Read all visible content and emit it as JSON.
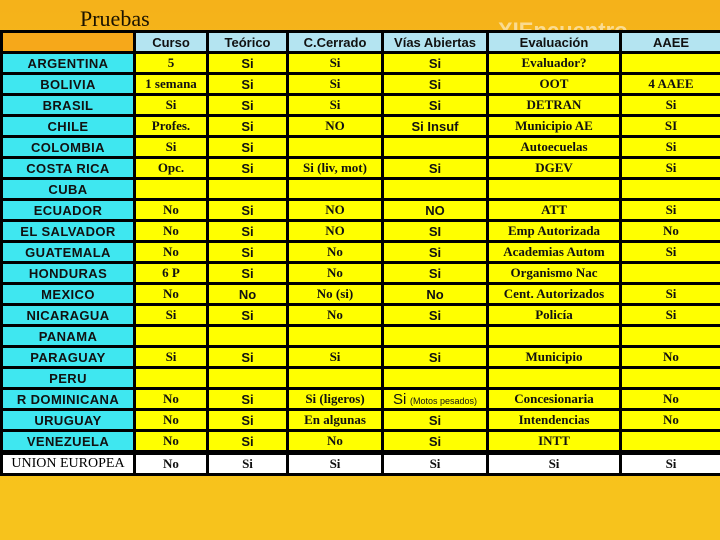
{
  "header": {
    "title": "Pruebas",
    "brand": "XIEncuentro"
  },
  "table": {
    "columns": [
      "Curso",
      "Teórico",
      "C.Cerrado",
      "Vías Abiertas",
      "Evaluación",
      "AAEE"
    ],
    "rows": [
      {
        "country": "ARGENTINA",
        "curso": "5",
        "teorico": "Si",
        "cerrado": "Si",
        "vias": "Si",
        "evaluacion": "Evaluador?",
        "aaee": ""
      },
      {
        "country": "BOLIVIA",
        "curso": "1 semana",
        "teorico": "Si",
        "cerrado": "Si",
        "vias": "Si",
        "evaluacion": "OOT",
        "aaee": "4 AAEE"
      },
      {
        "country": "BRASIL",
        "curso": "Si",
        "teorico": "Si",
        "cerrado": "Si",
        "vias": "Si",
        "evaluacion": "DETRAN",
        "aaee": "Si"
      },
      {
        "country": "CHILE",
        "curso": "Profes.",
        "teorico": "Si",
        "cerrado": "NO",
        "vias": "Si Insuf",
        "evaluacion": "Municipio AE",
        "aaee": "SI"
      },
      {
        "country": "COLOMBIA",
        "curso": "Si",
        "teorico": "Si",
        "cerrado": "",
        "vias": "",
        "evaluacion": "Autoecuelas",
        "aaee": "Si"
      },
      {
        "country": "COSTA RICA",
        "curso": "Opc.",
        "teorico": "Si",
        "cerrado": "Si (liv, mot)",
        "vias": "Si",
        "evaluacion": "DGEV",
        "aaee": "Si"
      },
      {
        "country": "CUBA",
        "curso": "",
        "teorico": "",
        "cerrado": "",
        "vias": "",
        "evaluacion": "",
        "aaee": ""
      },
      {
        "country": "ECUADOR",
        "curso": "No",
        "teorico": "Si",
        "cerrado": "NO",
        "vias": "NO",
        "evaluacion": "ATT",
        "aaee": "Si"
      },
      {
        "country": "EL SALVADOR",
        "curso": "No",
        "teorico": "Si",
        "cerrado": "NO",
        "vias": "SI",
        "evaluacion": "Emp Autorizada",
        "aaee": "No"
      },
      {
        "country": "GUATEMALA",
        "curso": "No",
        "teorico": "Si",
        "cerrado": "No",
        "vias": "Si",
        "evaluacion": "Academias Autom",
        "aaee": "Si"
      },
      {
        "country": "HONDURAS",
        "curso": "6 P",
        "teorico": "Si",
        "cerrado": "No",
        "vias": "Si",
        "evaluacion": "Organismo Nac",
        "aaee": ""
      },
      {
        "country": "MEXICO",
        "curso": "No",
        "teorico": "No",
        "cerrado": "No (si)",
        "vias": "No",
        "evaluacion": "Cent. Autorizados",
        "aaee": "Si"
      },
      {
        "country": "NICARAGUA",
        "curso": "Si",
        "teorico": "Si",
        "cerrado": "No",
        "vias": "Si",
        "evaluacion": "Policía",
        "aaee": "Si"
      },
      {
        "country": "PANAMA",
        "curso": "",
        "teorico": "",
        "cerrado": "",
        "vias": "",
        "evaluacion": "",
        "aaee": ""
      },
      {
        "country": "PARAGUAY",
        "curso": "Si",
        "teorico": "Si",
        "cerrado": "Si",
        "vias": "Si",
        "evaluacion": "Municipio",
        "aaee": "No"
      },
      {
        "country": "PERU",
        "curso": "",
        "teorico": "",
        "cerrado": "",
        "vias": "",
        "evaluacion": "",
        "aaee": ""
      },
      {
        "country": "R DOMINICANA",
        "curso": "No",
        "teorico": "Si",
        "cerrado": "Si (ligeros)",
        "vias": "Si",
        "vias_note": "(Motos pesados)",
        "evaluacion": "Concesionaria",
        "aaee": "No"
      },
      {
        "country": "URUGUAY",
        "curso": "No",
        "teorico": "Si",
        "cerrado": "En algunas",
        "vias": "Si",
        "evaluacion": "Intendencias",
        "aaee": "No"
      },
      {
        "country": "VENEZUELA",
        "curso": "No",
        "teorico": "Si",
        "cerrado": "No",
        "vias": "Si",
        "evaluacion": "INTT",
        "aaee": ""
      },
      {
        "country": "UNION EUROPEA",
        "curso": "No",
        "teorico": "Si",
        "cerrado": "Si",
        "vias": "Si",
        "evaluacion": "Si",
        "aaee": "Si"
      }
    ]
  },
  "colors": {
    "header_bg": "#b4e4f1",
    "country_bg": "#3fe7f0",
    "cell_bg": "#ffff00",
    "banner": "#f5b21a"
  }
}
